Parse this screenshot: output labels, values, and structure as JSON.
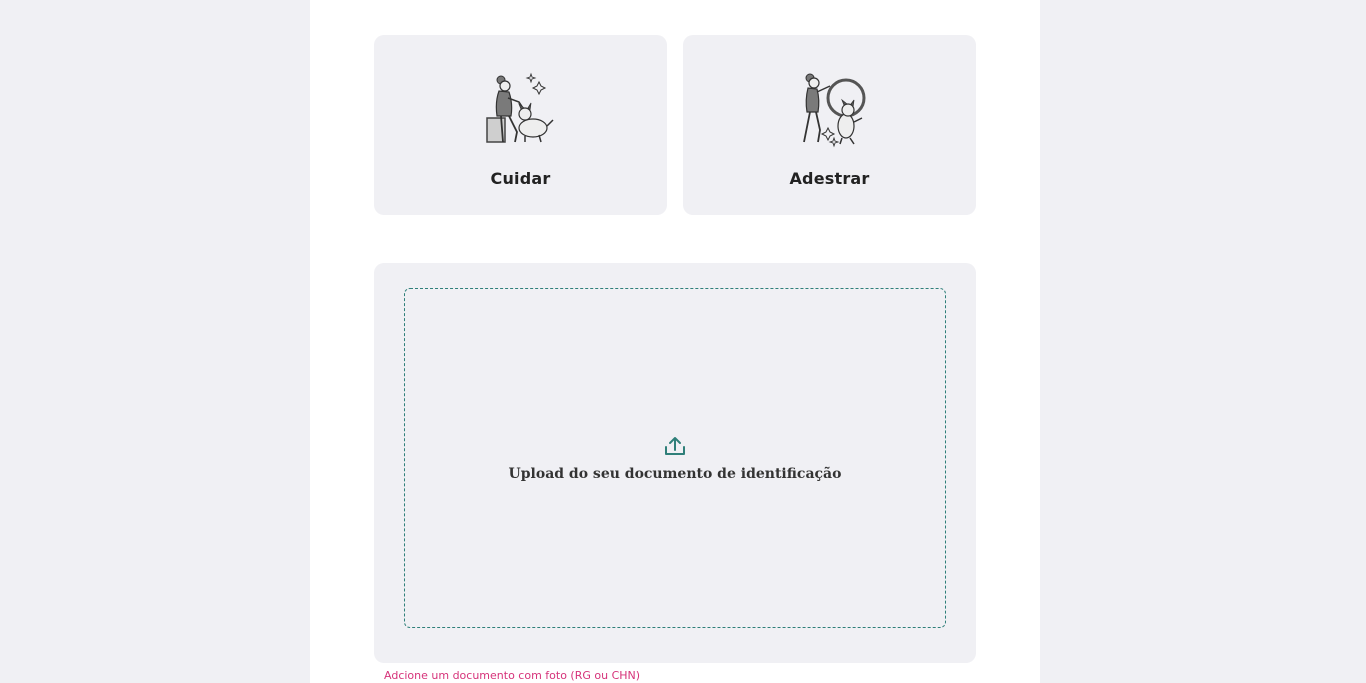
{
  "services": {
    "cuidar": {
      "label": "Cuidar",
      "icon": "pet-sitting-illustration-icon"
    },
    "adestrar": {
      "label": "Adestrar",
      "icon": "pet-training-illustration-icon"
    }
  },
  "upload": {
    "label": "Upload do seu documento de identificação",
    "icon": "upload-icon",
    "helper": "Adcione um documento com foto (RG ou CHN)"
  },
  "colors": {
    "background": "#f0f0f4",
    "card": "#f0f0f4",
    "accent": "#2f7f79",
    "error": "#d6337a"
  }
}
